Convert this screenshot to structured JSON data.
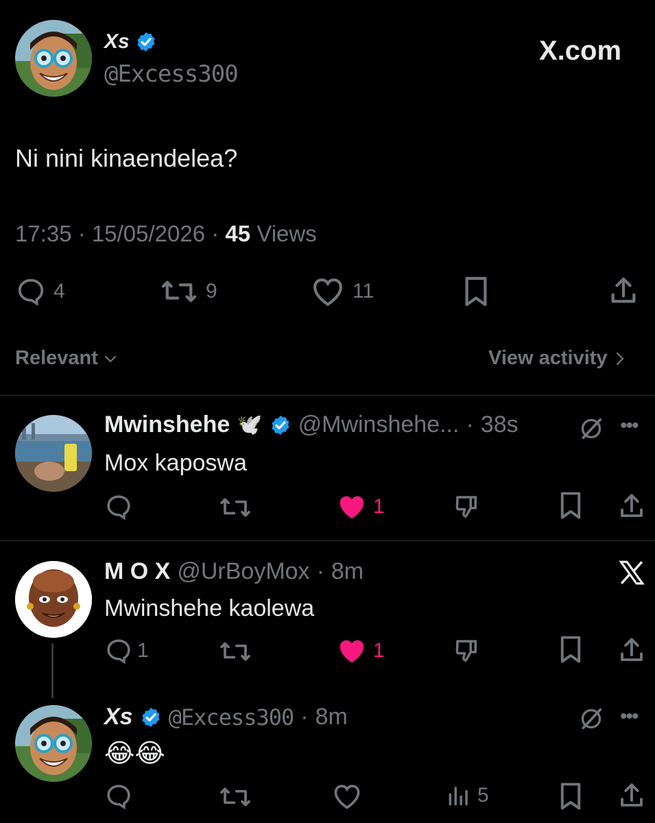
{
  "main_tweet": {
    "author_name": "Xs",
    "handle": "@Excess300",
    "brand": "X.com",
    "text": "Ni nini kinaendelea?",
    "time": "17:35",
    "date": "15/05/2026",
    "views_count": "45",
    "views_label": "Views",
    "replies": "4",
    "reposts": "9",
    "likes": "11"
  },
  "sort_bar": {
    "sort_label": "Relevant",
    "activity_label": "View activity"
  },
  "replies": [
    {
      "name": "Mwinshehe",
      "emoji": "🕊️",
      "handle": "@Mwinshehe...",
      "time": "38s",
      "text": "Mox kaposwa",
      "likes": "1"
    },
    {
      "name": "M O X",
      "handle": "@UrBoyMox",
      "time": "8m",
      "text": "Mwinshehe kaolewa",
      "replies": "1",
      "likes": "1"
    },
    {
      "name": "Xs",
      "handle": "@Excess300",
      "time": "8m",
      "text": "😂😂",
      "views": "5"
    }
  ],
  "colors": {
    "background": "#000000",
    "text": "#e7e9ea",
    "muted": "#71767b",
    "like_active": "#f91880",
    "verified": "#1d9bf0"
  }
}
